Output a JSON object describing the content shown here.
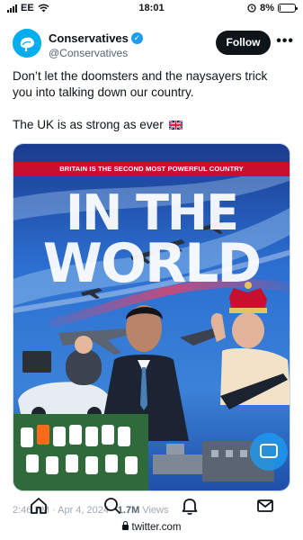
{
  "status_bar": {
    "carrier": "EE",
    "time": "18:01",
    "battery": "8%",
    "battery_level": 0.08
  },
  "tweet": {
    "author": {
      "display_name": "Conservatives",
      "handle": "@Conservatives",
      "verified": true
    },
    "follow_label": "Follow",
    "more_label": "•••",
    "text_line_1": "Don’t let the doomsters and the naysayers trick you into talking down our country.",
    "text_line_2": "The UK is as strong as ever",
    "media": {
      "banner": "BRITAIN IS THE SECOND MOST POWERFUL COUNTRY",
      "headline_1": "IN THE",
      "headline_2": "WORLD"
    },
    "meta_time": "2:46 PM · Apr 4, 2024 ·",
    "views_count": "1.7M",
    "views_label": "Views"
  },
  "browser": {
    "url": "twitter.com"
  },
  "colors": {
    "accent": "#1d9bf0",
    "banner_red": "#c8102e",
    "follow_bg": "#0f1419",
    "conservative_blue": "#00aeef"
  },
  "icons": [
    "signal-icon",
    "wifi-icon",
    "alarm-icon",
    "battery-icon",
    "verified-icon",
    "more-icon",
    "union-jack-icon",
    "home-icon",
    "search-icon",
    "notifications-icon",
    "messages-icon",
    "lock-icon"
  ]
}
